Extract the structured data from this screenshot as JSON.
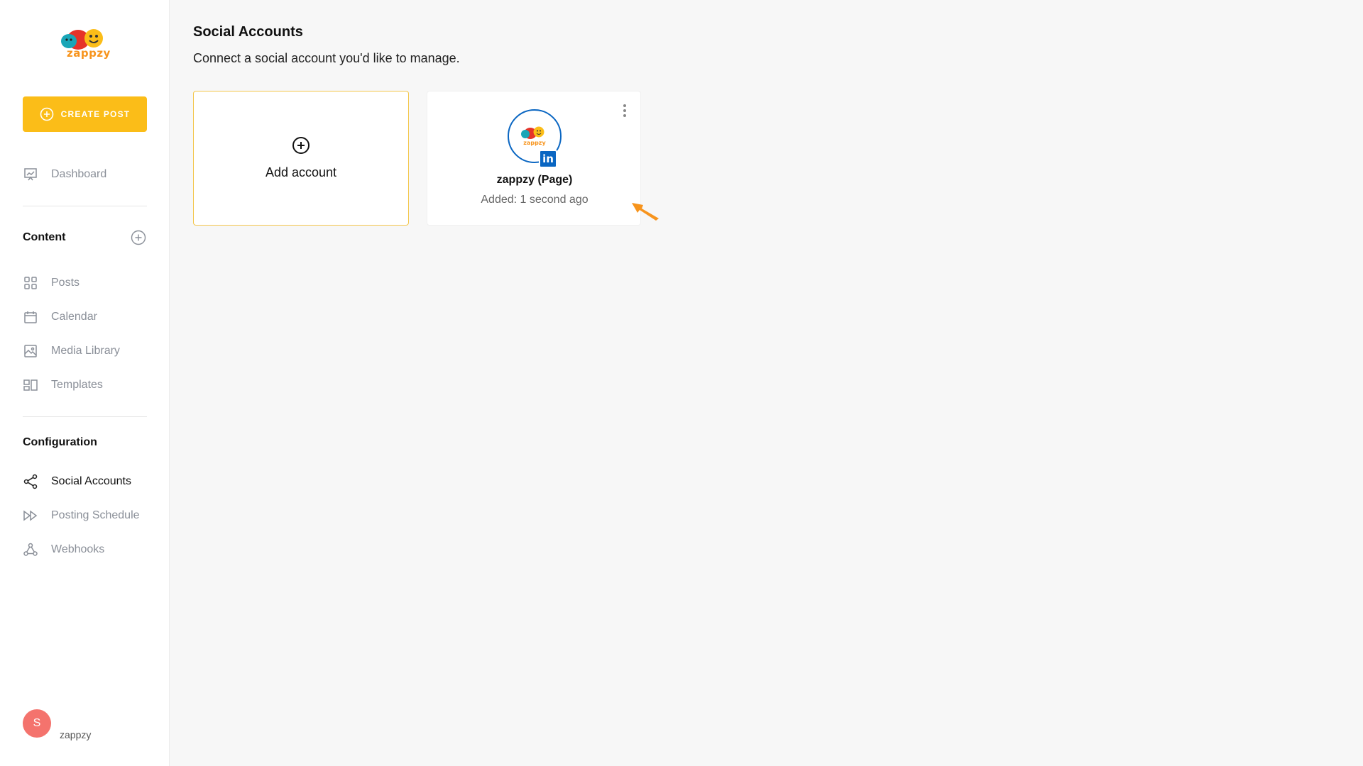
{
  "brand": {
    "name": "zappzy",
    "accent": "#fbbd18",
    "logo_orange": "#f7941d"
  },
  "sidebar": {
    "create_label": "CREATE POST",
    "items_top": [
      {
        "label": "Dashboard",
        "icon": "presentation-chart-icon"
      }
    ],
    "content_section": "Content",
    "content_items": [
      {
        "label": "Posts",
        "icon": "grid-icon"
      },
      {
        "label": "Calendar",
        "icon": "calendar-icon"
      },
      {
        "label": "Media Library",
        "icon": "image-icon"
      },
      {
        "label": "Templates",
        "icon": "template-icon"
      }
    ],
    "config_section": "Configuration",
    "config_items": [
      {
        "label": "Social Accounts",
        "icon": "share-icon",
        "active": true
      },
      {
        "label": "Posting Schedule",
        "icon": "fast-forward-icon"
      },
      {
        "label": "Webhooks",
        "icon": "webhook-icon"
      }
    ],
    "user": {
      "initial": "S",
      "name": "zappzy",
      "avatar_color": "#f4736d"
    }
  },
  "main": {
    "title": "Social Accounts",
    "subtitle": "Connect a social account you'd like to manage.",
    "add_card": {
      "label": "Add account"
    },
    "accounts": [
      {
        "name": "zappzy (Page)",
        "added": "Added: 1 second ago",
        "network": "linkedin",
        "network_badge": "in",
        "network_color": "#0a66c2"
      }
    ]
  }
}
